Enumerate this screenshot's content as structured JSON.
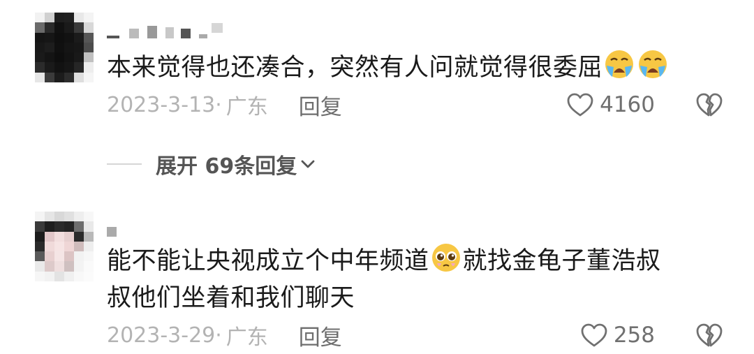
{
  "comments": [
    {
      "text": "本来觉得也还凑合，突然有人问就觉得很委屈",
      "emojis": [
        "loudly-crying-face",
        "loudly-crying-face"
      ],
      "date": "2023-3-13·",
      "location": "广东",
      "reply_label": "回复",
      "likes": "4160",
      "expand_label": "展开 69条回复"
    },
    {
      "text_line1_a": "能不能让央视成立个中年频道",
      "emoji": "pleading-face",
      "text_line1_b": "就找金龟子董浩叔",
      "text_line2": "叔他们坐着和我们聊天",
      "date": "2023-3-29·",
      "location": "广东",
      "reply_label": "回复",
      "likes": "258"
    }
  ],
  "icons": {
    "like": "heart-outline-icon",
    "dislike": "broken-heart-icon",
    "expand": "chevron-down-icon"
  },
  "colors": {
    "text": "#1a1a1a",
    "meta": "#b3b3b3",
    "action": "#6e6e6e",
    "background": "#ffffff"
  }
}
